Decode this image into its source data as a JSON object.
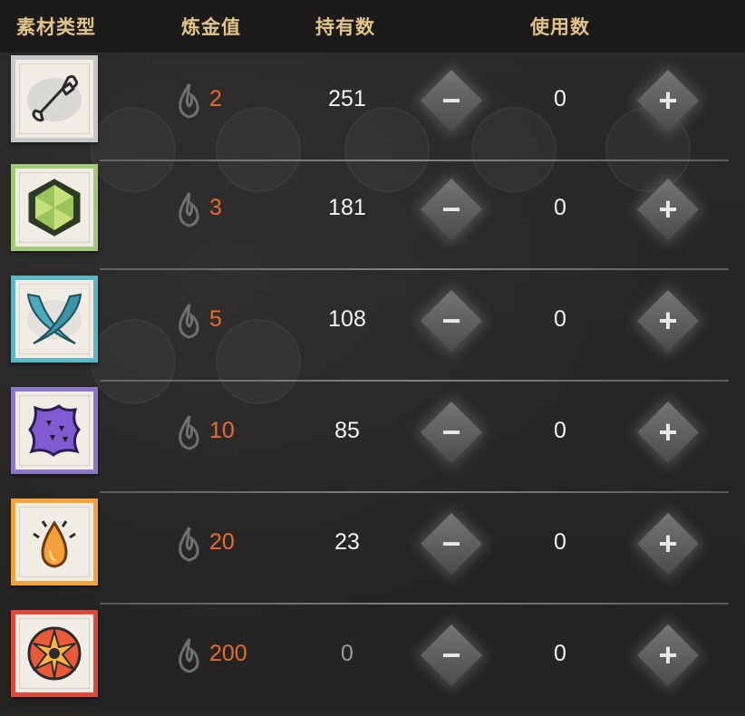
{
  "header": {
    "material_type": "素材类型",
    "alchemy_value": "炼金值",
    "owned_count": "持有数",
    "used_count": "使用数"
  },
  "colors": {
    "header_text": "#e2c48a",
    "alchemy_value": "#ea6a2c",
    "grey_frame": "#c7c7c7",
    "green_frame": "#a4c97a",
    "teal_frame": "#5bb6c6",
    "purple_frame": "#8a78c6",
    "orange_frame": "#f0a43a",
    "red_frame": "#e0483a"
  },
  "controls": {
    "minus_label": "−",
    "plus_label": "+"
  },
  "rows": [
    {
      "icon": "bone-icon",
      "alchemy_value": "2",
      "owned": "251",
      "used": "0"
    },
    {
      "icon": "hexagon-crystal-icon",
      "alchemy_value": "3",
      "owned": "181",
      "used": "0"
    },
    {
      "icon": "crossed-fangs-icon",
      "alchemy_value": "5",
      "owned": "108",
      "used": "0"
    },
    {
      "icon": "purple-hide-icon",
      "alchemy_value": "10",
      "owned": "85",
      "used": "0"
    },
    {
      "icon": "amber-drop-icon",
      "alchemy_value": "20",
      "owned": "23",
      "used": "0"
    },
    {
      "icon": "red-star-core-icon",
      "alchemy_value": "200",
      "owned": "0",
      "used": "0"
    }
  ]
}
